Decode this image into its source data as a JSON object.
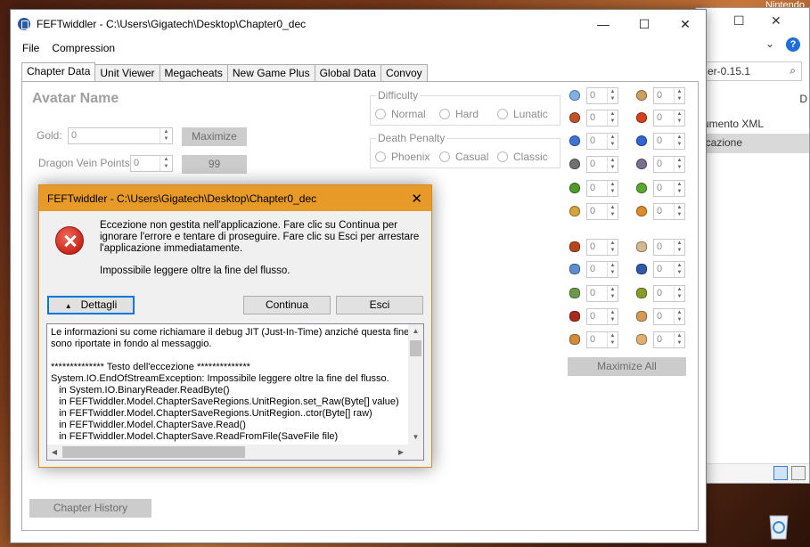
{
  "desktop": {
    "corner_label": "Nintendo"
  },
  "background_window": {
    "address_fragment": "er-0.15.1",
    "search_icon": "search-icon",
    "side_letter": "D",
    "rows": [
      "umento XML",
      "icazione"
    ],
    "help": "?"
  },
  "main_window": {
    "title": "FEFTwiddler - C:\\Users\\Gigatech\\Desktop\\Chapter0_dec",
    "menu": [
      "File",
      "Compression"
    ],
    "tabs": [
      "Chapter Data",
      "Unit Viewer",
      "Megacheats",
      "New Game Plus",
      "Global Data",
      "Convoy"
    ],
    "active_tab": "Chapter Data",
    "avatar_name": "Avatar Name",
    "gold_label": "Gold:",
    "gold_value": "0",
    "maximize_label": "Maximize",
    "dragon_vein_label": "Dragon Vein Points:",
    "dragon_vein_value": "0",
    "dragon_vein_max": "99",
    "difficulty": {
      "title": "Difficulty",
      "options": [
        "Normal",
        "Hard",
        "Lunatic"
      ]
    },
    "death_penalty": {
      "title": "Death Penalty",
      "options": [
        "Phoenix",
        "Casual",
        "Classic"
      ]
    },
    "item_values": [
      "0",
      "0",
      "0",
      "0",
      "0",
      "0",
      "0",
      "0",
      "0",
      "0",
      "0",
      "0",
      "0",
      "0",
      "0",
      "0",
      "0",
      "0",
      "0",
      "0",
      "0",
      "0"
    ],
    "item_icon_colors": {
      "gem_col1": [
        "#7fb0e8",
        "#c0522b",
        "#3e74d6",
        "#707070",
        "#4e9a2a",
        "#d6a23a"
      ],
      "gem_col2": [
        "#caa060",
        "#d2421c",
        "#2f66d0",
        "#7a6f8c",
        "#58a830",
        "#e08a2e"
      ],
      "food_col1": [
        "#b8461c",
        "#5b8fd0",
        "#6c9a4a",
        "#a82a1a",
        "#d08c3a"
      ],
      "food_col2": [
        "#d4b890",
        "#2f5aa8",
        "#8a9a2a",
        "#d49a5a",
        "#e0b070"
      ]
    },
    "maximize_all_label": "Maximize All",
    "chapter_history_label": "Chapter History"
  },
  "dialog": {
    "title": "FEFTwiddler - C:\\Users\\Gigatech\\Desktop\\Chapter0_dec",
    "message": "Eccezione non gestita nell'applicazione. Fare clic su Continua per ignorare l'errore e tentare di proseguire. Fare clic su Esci per arrestare l'applicazione immediatamente.",
    "message2": "Impossibile leggere oltre la fine del flusso.",
    "details_label": "Dettagli",
    "continue_label": "Continua",
    "exit_label": "Esci",
    "details_text": "Le informazioni su come richiamare il debug JIT (Just-In-Time) anziché questa finestra\nsono riportate in fondo al messaggio.\n\n************** Testo dell'eccezione **************\nSystem.IO.EndOfStreamException: Impossibile leggere oltre la fine del flusso.\n   in System.IO.BinaryReader.ReadByte()\n   in FEFTwiddler.Model.ChapterSaveRegions.UnitRegion.set_Raw(Byte[] value)\n   in FEFTwiddler.Model.ChapterSaveRegions.UnitRegion..ctor(Byte[] raw)\n   in FEFTwiddler.Model.ChapterSave.Read()\n   in FEFTwiddler.Model.ChapterSave.ReadFromFile(SaveFile file)"
  }
}
